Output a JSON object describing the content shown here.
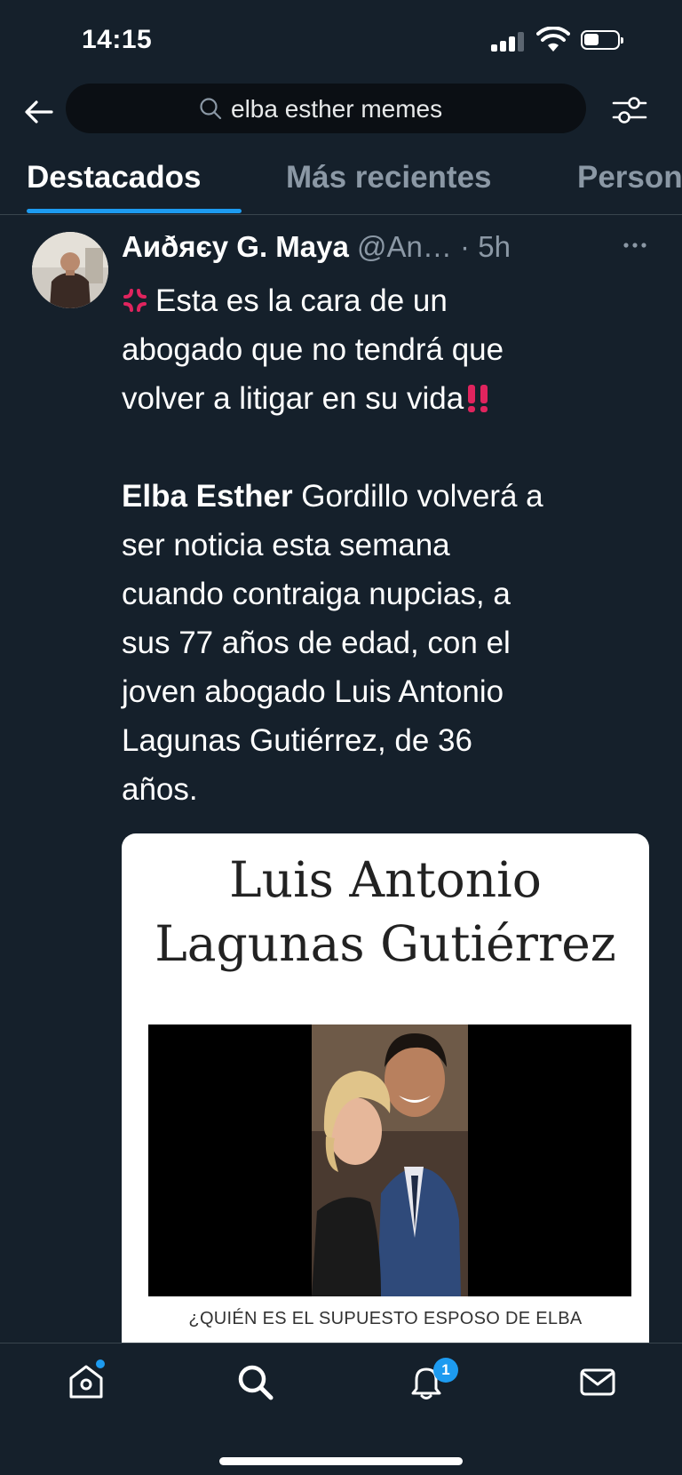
{
  "status_bar": {
    "time": "14:15"
  },
  "search": {
    "query": "elba esther memes"
  },
  "tabs": [
    {
      "label": "Destacados",
      "active": true
    },
    {
      "label": "Más recientes",
      "active": false
    },
    {
      "label": "Personas",
      "active": false
    }
  ],
  "tweet": {
    "author_name": "Аиðяєу G. Maya",
    "handle": "@An…",
    "separator": " · ",
    "time": "5h",
    "lines_intro": [
      "Esta es la cara de un",
      "abogado que no tendrá que",
      "volver a litigar en su vida"
    ],
    "bold_name": "Elba Esther",
    "lines_body_first_rest": " Gordillo volverá a",
    "lines_body": [
      "ser noticia esta semana",
      "cuando contraiga nupcias, a",
      "sus 77 años de edad, con el",
      "joven abogado Luis Antonio",
      "Lagunas Gutiérrez, de 36",
      "años."
    ],
    "media": {
      "title_line1": "Luis Antonio",
      "title_line2": "Lagunas Gutiérrez",
      "caption": "¿QUIÉN ES EL SUPUESTO ESPOSO DE ELBA"
    }
  },
  "bottom_nav": {
    "notifications_badge": "1"
  },
  "colors": {
    "background": "#15202b",
    "accent": "#1d9bf0",
    "secondary_text": "#8b98a5",
    "anger_icon": "#e0245e",
    "exclamation_icon": "#e0245e"
  }
}
